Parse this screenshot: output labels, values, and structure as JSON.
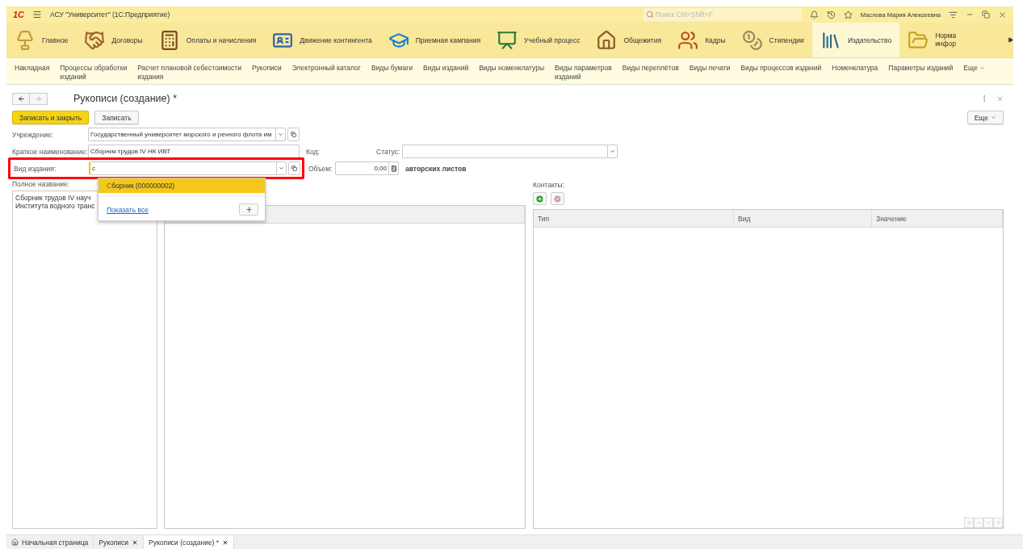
{
  "window": {
    "logo": "1С",
    "title": "АСУ \"Университет\"  (1С:Предприятие)",
    "search_placeholder": "Поиск Ctrl+Shift+F",
    "user": "Маслова Мария Алексеевна"
  },
  "sections": [
    {
      "label": "Главное",
      "selected": false
    },
    {
      "label": "Договоры",
      "selected": false
    },
    {
      "label": "Оплаты и начисления",
      "selected": false
    },
    {
      "label": "Движение контингента",
      "selected": false
    },
    {
      "label": "Приемная кампания",
      "selected": false
    },
    {
      "label": "Учебный процесс",
      "selected": false
    },
    {
      "label": "Общежития",
      "selected": false
    },
    {
      "label": "Кадры",
      "selected": false
    },
    {
      "label": "Стипендии",
      "selected": false
    },
    {
      "label": "Издательство",
      "selected": true
    },
    {
      "label": "Норма инфор",
      "selected": false
    }
  ],
  "nav": [
    {
      "lines": [
        "Накладная"
      ]
    },
    {
      "lines": [
        "Процессы обработки",
        "изданий"
      ]
    },
    {
      "lines": [
        "Расчет плановой себестоимости",
        "издания"
      ]
    },
    {
      "lines": [
        "Рукописи"
      ]
    },
    {
      "lines": [
        "Электронный каталог"
      ]
    },
    {
      "lines": [
        "Виды бумаги"
      ]
    },
    {
      "lines": [
        "Виды изданий"
      ]
    },
    {
      "lines": [
        "Виды номенклатуры"
      ]
    },
    {
      "lines": [
        "Виды параметров",
        "изданий"
      ]
    },
    {
      "lines": [
        "Виды переплётов"
      ]
    },
    {
      "lines": [
        "Виды печати"
      ]
    },
    {
      "lines": [
        "Виды процессов изданий"
      ]
    },
    {
      "lines": [
        "Номенклатура"
      ]
    },
    {
      "lines": [
        "Параметры изданий"
      ]
    },
    {
      "lines": [
        "Еще"
      ]
    }
  ],
  "form": {
    "title": "Рукописи (создание) *",
    "save_close": "Записать и закрыть",
    "save": "Записать",
    "more": "Еще",
    "institution": {
      "label": "Учреждение:",
      "value": "Государственный университет морского и речного флота им"
    },
    "short_name": {
      "label": "Краткое наименование:",
      "value": "Сборник трудов IV НК ИВТ"
    },
    "code": {
      "label": "Код:"
    },
    "status": {
      "label": "Статус:"
    },
    "kind": {
      "label": "Вид издания:",
      "value": "с",
      "highlighted": true
    },
    "volume": {
      "label": "Объем:",
      "value": "0,00",
      "unit": "авторских листов"
    },
    "full_name": {
      "label": "Полное название:",
      "lines": [
        "Сборник трудов IV науч",
        "Института водного транс"
      ]
    },
    "dropdown": {
      "items": [
        {
          "match": "С",
          "rest": "борник (000000002)",
          "selected": true
        }
      ],
      "show_all": "Показать все"
    },
    "contacts": {
      "label": "Контакты:",
      "columns": [
        "Тип",
        "Вид",
        "Значение"
      ]
    }
  },
  "tabs": [
    {
      "label": "Начальная страница",
      "kind": "home",
      "selected": false
    },
    {
      "label": "Рукописи",
      "kind": "page",
      "selected": false
    },
    {
      "label": "Рукописи (создание) *",
      "kind": "page",
      "selected": true
    }
  ]
}
